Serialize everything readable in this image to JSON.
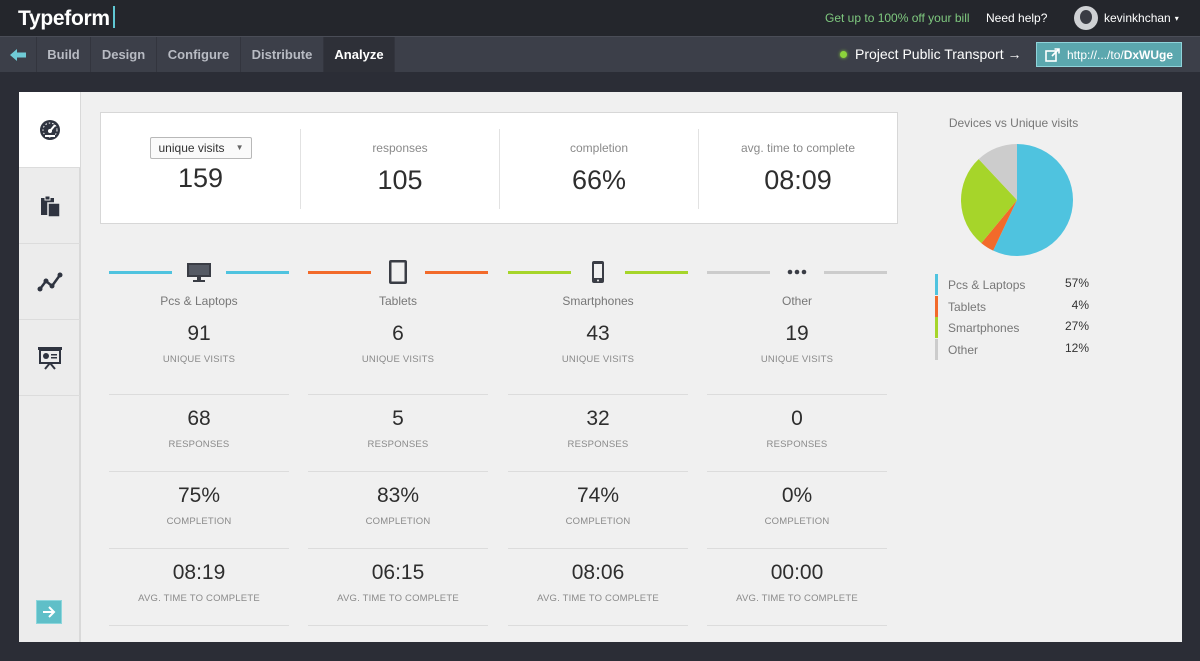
{
  "app": {
    "logo": "Typeform"
  },
  "topbar": {
    "promo": "Get up to 100% off your bill",
    "help": "Need help?",
    "username": "kevinkhchan",
    "user_caret": "▾"
  },
  "nav": {
    "back_icon": "arrow-left-icon",
    "tabs": [
      {
        "label": "Build"
      },
      {
        "label": "Design"
      },
      {
        "label": "Configure"
      },
      {
        "label": "Distribute"
      },
      {
        "label": "Analyze",
        "active": true
      }
    ],
    "project": "Project Public Transport →",
    "link_prefix": "http://.../to/",
    "link_code": "DxWUge",
    "link_icon": "external-link-icon"
  },
  "sidebar": {
    "items": [
      {
        "icon": "dashboard-gauge-icon",
        "active": true
      },
      {
        "icon": "clipboard-icon"
      },
      {
        "icon": "line-chart-icon"
      },
      {
        "icon": "presentation-icon"
      }
    ],
    "next_icon": "arrow-right-icon"
  },
  "summary": {
    "select_value": "unique visits",
    "select_caret": "▼",
    "visits": "159",
    "responses_label": "responses",
    "responses": "105",
    "completion_label": "completion",
    "completion": "66%",
    "avg_time_label": "avg. time to complete",
    "avg_time": "08:09"
  },
  "stat_labels": {
    "visits": "UNIQUE VISITS",
    "responses": "RESPONSES",
    "completion": "COMPLETION",
    "avg_time": "AVG. TIME TO COMPLETE"
  },
  "devices": [
    {
      "name": "Pcs & Laptops",
      "icon": "desktop-icon",
      "color": "#4fc3df",
      "visits": "91",
      "responses": "68",
      "completion": "75%",
      "avg_time": "08:19"
    },
    {
      "name": "Tablets",
      "icon": "tablet-icon",
      "color": "#f26a2a",
      "visits": "6",
      "responses": "5",
      "completion": "83%",
      "avg_time": "06:15"
    },
    {
      "name": "Smartphones",
      "icon": "smartphone-icon",
      "color": "#a6d52a",
      "visits": "43",
      "responses": "32",
      "completion": "74%",
      "avg_time": "08:06"
    },
    {
      "name": "Other",
      "icon": "more-dots-icon",
      "color": "#cccccc",
      "visits": "19",
      "responses": "0",
      "completion": "0%",
      "avg_time": "00:00"
    }
  ],
  "chart_data": {
    "type": "pie",
    "title": "Devices vs Unique visits",
    "categories": [
      "Pcs & Laptops",
      "Tablets",
      "Smartphones",
      "Other"
    ],
    "values": [
      57,
      4,
      27,
      12
    ],
    "labels": [
      "57%",
      "4%",
      "27%",
      "12%"
    ],
    "colors": [
      "#4fc3df",
      "#f26a2a",
      "#a6d52a",
      "#cccccc"
    ],
    "legend": "bottom"
  }
}
